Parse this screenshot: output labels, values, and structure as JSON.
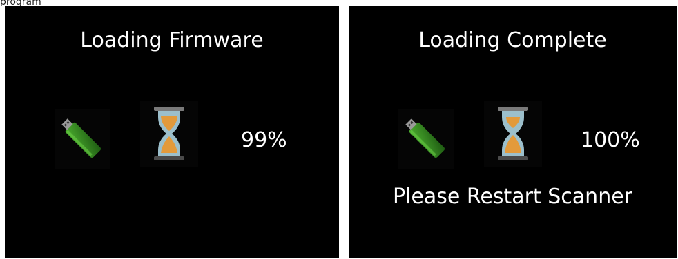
{
  "caption_partial": "program",
  "panels": [
    {
      "title": "Loading Firmware",
      "progress_text": "99%",
      "progress_value": 99,
      "message": ""
    },
    {
      "title": "Loading Complete",
      "progress_text": "100%",
      "progress_value": 100,
      "message": "Please Restart Scanner"
    }
  ],
  "icons": {
    "usb": "usb-drive-icon",
    "hourglass": "hourglass-icon"
  },
  "colors": {
    "screen_bg": "#000000",
    "text": "#ffffff",
    "usb_green": "#2e7d1e",
    "sand_orange": "#e39a3b",
    "glass_blue": "#8fb5c2"
  }
}
